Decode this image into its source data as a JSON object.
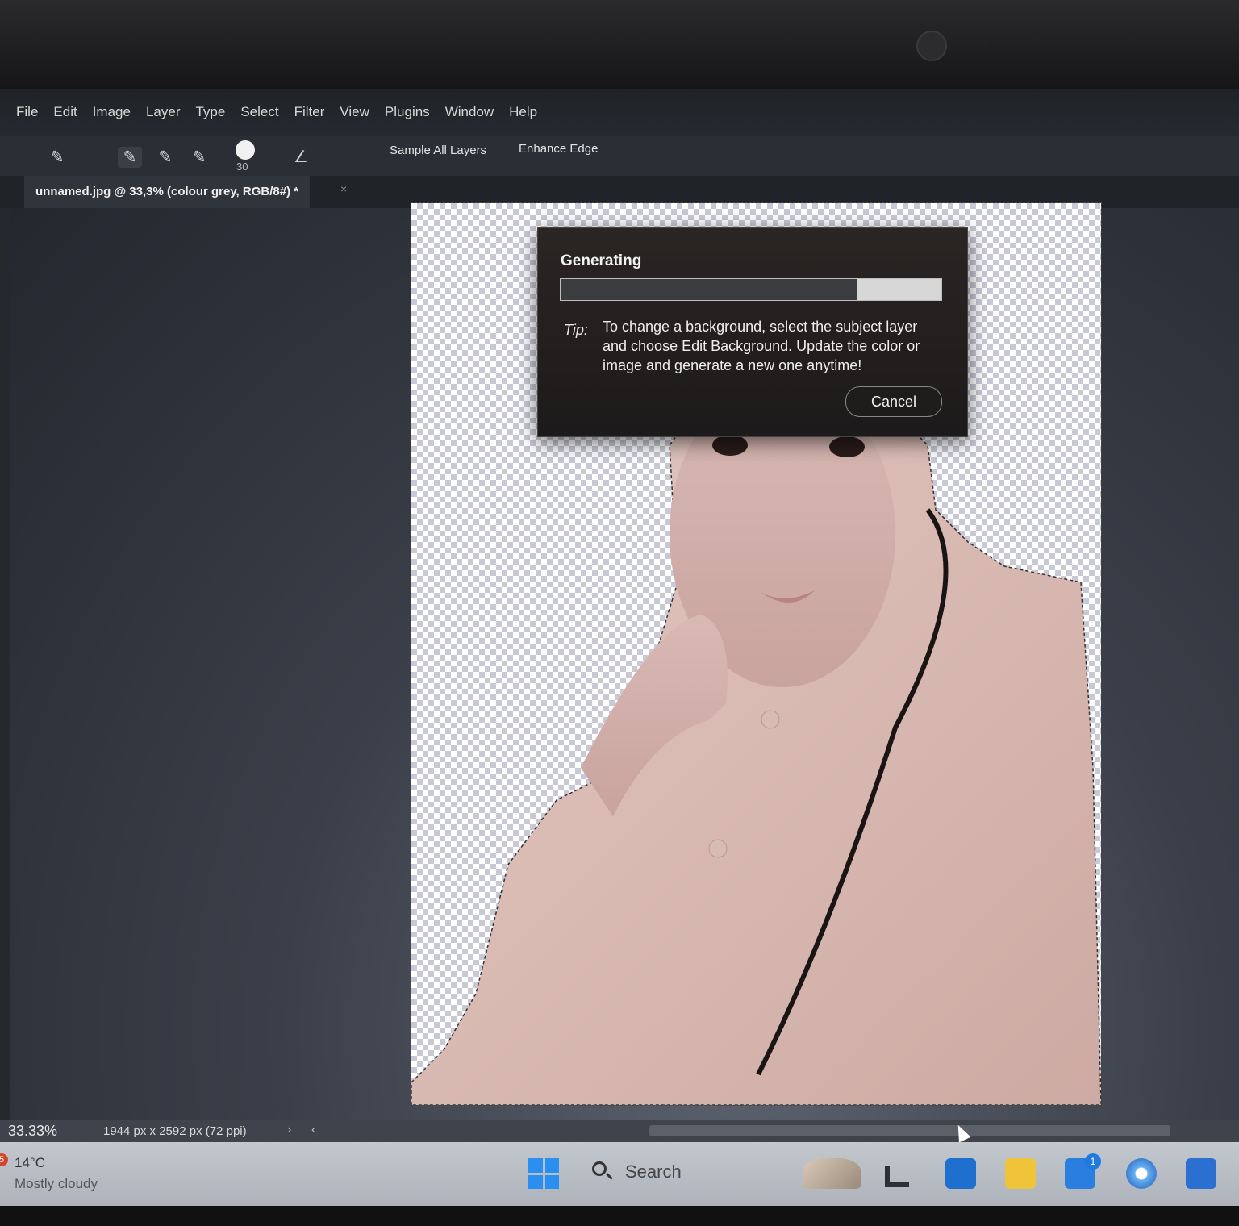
{
  "menu": [
    "File",
    "Edit",
    "Image",
    "Layer",
    "Type",
    "Select",
    "Filter",
    "View",
    "Plugins",
    "Window",
    "Help"
  ],
  "options": {
    "brush_size": "30",
    "sample_all_layers": "Sample All Layers",
    "enhance_edge": "Enhance Edge"
  },
  "document_tab": {
    "title": "unnamed.jpg @ 33,3% (colour grey, RGB/8#) *",
    "close": "×"
  },
  "dialog": {
    "title": "Generating",
    "progress": 0.78,
    "tip_label": "Tip:",
    "tip_text": "To change a background, select the subject layer and choose Edit Background. Update the color or image and generate a new one anytime!",
    "cancel_label": "Cancel"
  },
  "status": {
    "zoom": "33.33%",
    "doc_size": "1944 px x 2592 px (72 ppi)",
    "next": "›",
    "prev": "‹"
  },
  "taskbar": {
    "weather_badge": "5",
    "temperature": "14°C",
    "weather_desc": "Mostly cloudy",
    "search_placeholder": "Search",
    "notification_count": "1"
  },
  "icons": [
    "quick-selection-icon",
    "add-selection-icon",
    "subtract-selection-icon",
    "brush-angle-icon",
    "windows-start-icon",
    "search-icon",
    "file-explorer-icon",
    "outlook-icon",
    "store-icon",
    "copilot-icon"
  ],
  "colors": {
    "accent": "#2a8ff0",
    "dialog_bg": "#221f1f",
    "workspace": "#3a3f49"
  }
}
